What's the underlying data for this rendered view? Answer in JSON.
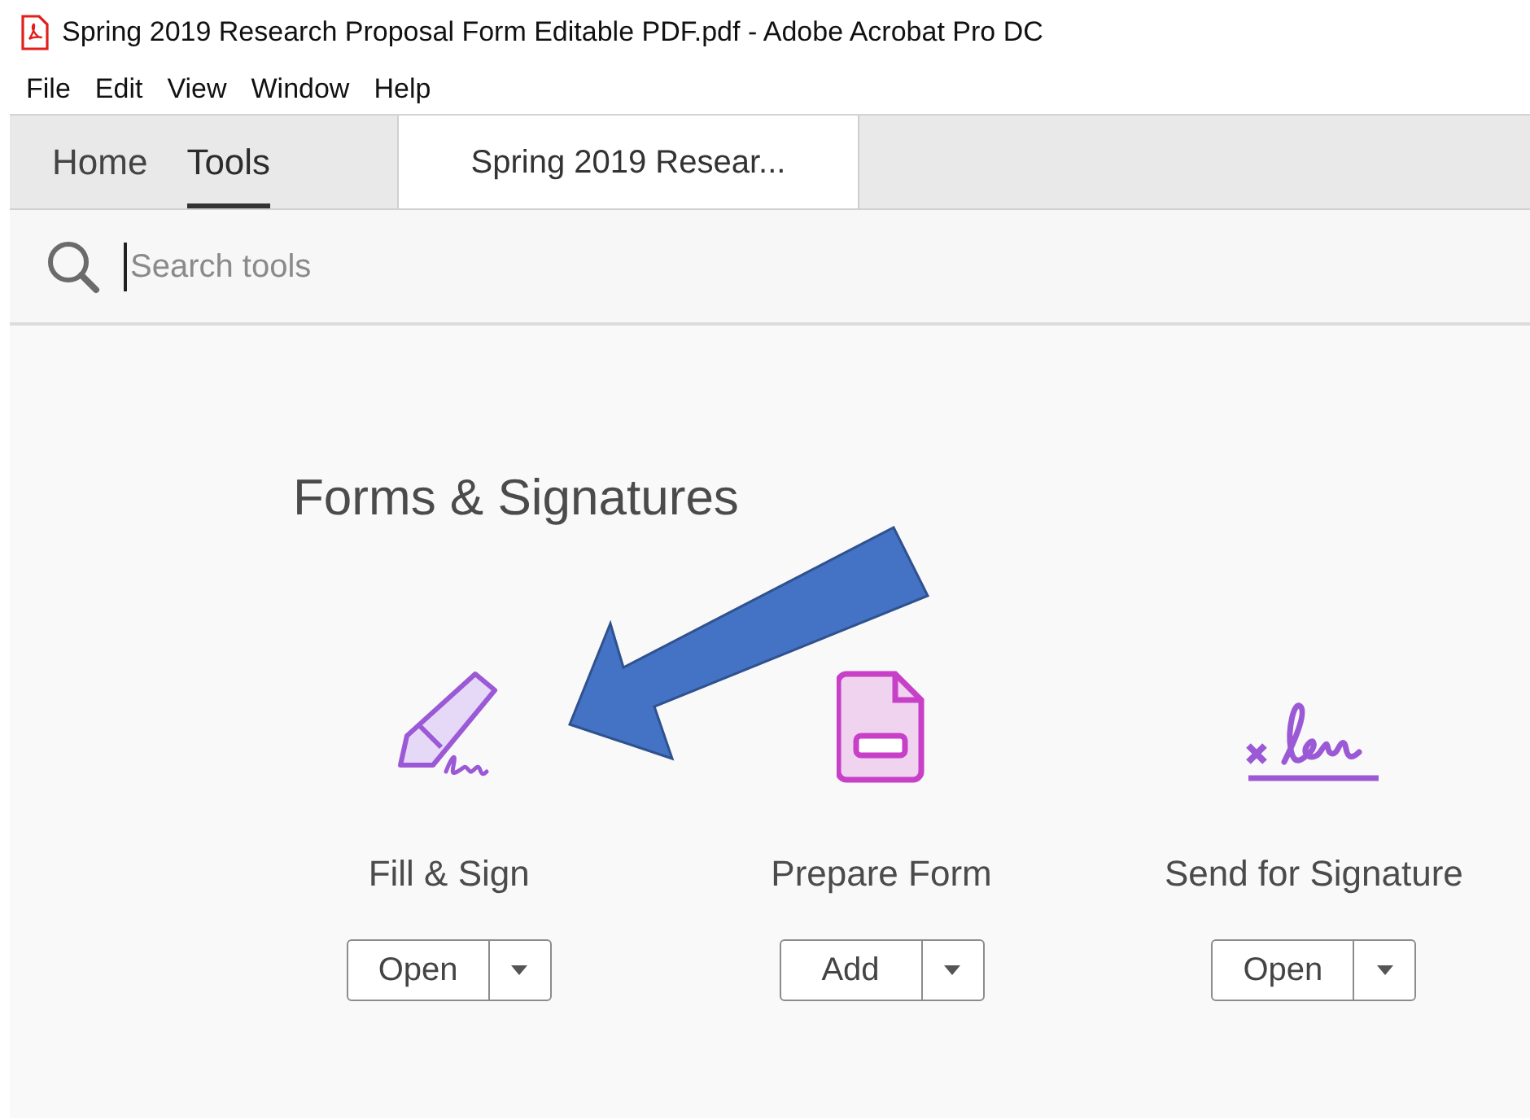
{
  "window": {
    "title": "Spring 2019 Research Proposal Form Editable PDF.pdf - Adobe Acrobat Pro DC"
  },
  "menu": [
    "File",
    "Edit",
    "View",
    "Window",
    "Help"
  ],
  "tabs": [
    {
      "label": "Home",
      "selected": false
    },
    {
      "label": "Tools",
      "selected": true
    }
  ],
  "document_tab": {
    "label": "Spring 2019 Resear..."
  },
  "search": {
    "placeholder": "Search tools"
  },
  "section": {
    "title": "Forms & Signatures"
  },
  "tools": [
    {
      "kind": "fill-sign",
      "label": "Fill & Sign",
      "button": "Open"
    },
    {
      "kind": "prepare-form",
      "label": "Prepare Form",
      "button": "Add"
    },
    {
      "kind": "send-signature",
      "label": "Send for Signature",
      "button": "Open"
    }
  ]
}
